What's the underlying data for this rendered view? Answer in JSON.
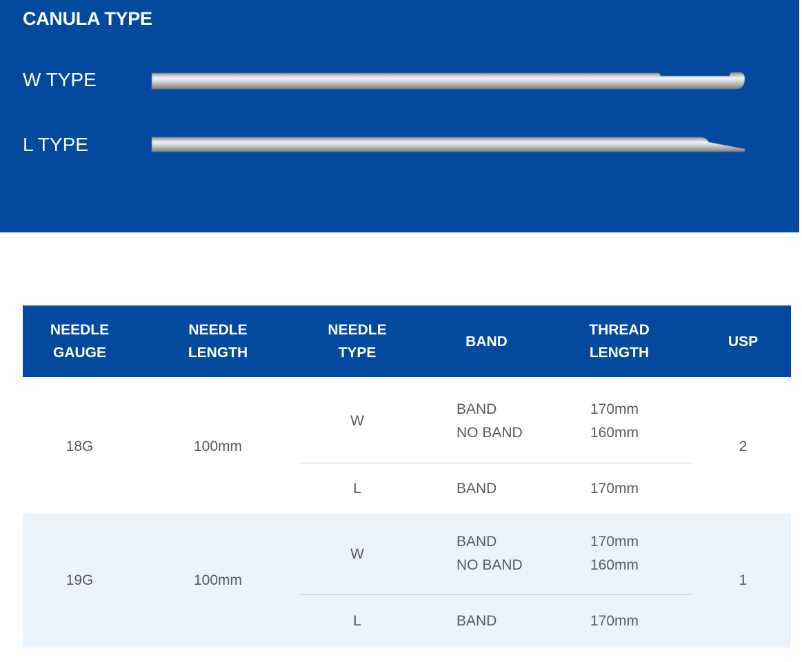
{
  "canula": {
    "title": "CANULA TYPE",
    "types": [
      {
        "label": "W TYPE",
        "tip": "blunt-notch"
      },
      {
        "label": "L TYPE",
        "tip": "bevel"
      }
    ],
    "colors": {
      "panel": "#034a9f",
      "text": "#ffffff",
      "needle": "#c8c9cb"
    }
  },
  "table": {
    "headers": [
      "NEEDLE\nGAUGE",
      "NEEDLE\nLENGTH",
      "NEEDLE\nTYPE",
      "BAND",
      "THREAD\nLENGTH",
      "USP"
    ],
    "groups": [
      {
        "gauge": "18G",
        "length": "100mm",
        "usp": "2",
        "rows": [
          {
            "type": "W",
            "band": "BAND\nNO BAND",
            "thread": "170mm\n160mm"
          },
          {
            "type": "L",
            "band": "BAND",
            "thread": "170mm"
          }
        ]
      },
      {
        "gauge": "19G",
        "length": "100mm",
        "usp": "1",
        "rows": [
          {
            "type": "W",
            "band": "BAND\nNO BAND",
            "thread": "170mm\n160mm"
          },
          {
            "type": "L",
            "band": "BAND",
            "thread": "170mm"
          }
        ]
      }
    ],
    "colors": {
      "header": "#034a9f",
      "alt_row": "#ebf3fd",
      "divider": "#c6ccd4",
      "text": "#555a60"
    }
  }
}
